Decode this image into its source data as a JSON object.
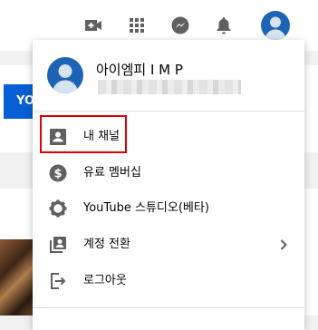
{
  "topbar": {
    "icons": [
      "create-video-icon",
      "apps-grid-icon",
      "messages-icon",
      "notifications-bell-icon"
    ],
    "avatar": "account-avatar"
  },
  "background": {
    "chip_label": "YO"
  },
  "account_menu": {
    "name": "아이엠피 I M P",
    "email_redacted": true,
    "items": [
      {
        "label": "내 채널",
        "icon": "account-box-icon",
        "highlighted": true
      },
      {
        "label": "유료 멤버십",
        "icon": "dollar-circle-icon"
      },
      {
        "label": "YouTube 스튜디오(베타)",
        "icon": "gear-icon"
      },
      {
        "label": "계정 전환",
        "icon": "switch-account-icon",
        "has_submenu": true
      },
      {
        "label": "로그아웃",
        "icon": "sign-out-icon"
      }
    ]
  },
  "colors": {
    "accent_blue": "#065fd4",
    "avatar_blue": "#1e63b4",
    "highlight_red": "#e00000",
    "icon_gray": "#606060"
  }
}
